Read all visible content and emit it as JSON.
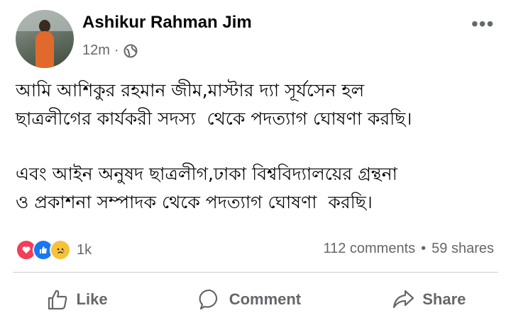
{
  "post": {
    "author": "Ashikur Rahman Jim",
    "time": "12m",
    "visibility_icon": "globe-icon",
    "paragraph1": "আমি আশিকুর রহমান জীম,মাস্টার দ্যা সূর্যসেন হল\nছাত্রলীগের কার্যকরী সদস্য  থেকে পদত্যাগ ঘোষণা করছি।",
    "paragraph2": "এবং আইন অনুষদ ছাত্রলীগ,ঢাকা বিশ্ববিদ্যালয়ের গ্রন্থনা\nও প্রকাশনা সম্পাদক থেকে পদত্যাগ ঘোষণা  করছি।"
  },
  "engagement": {
    "reaction_icons": [
      "love-icon",
      "like-icon",
      "sad-icon"
    ],
    "reaction_count": "1k",
    "comments": "112 comments",
    "separator": "•",
    "shares": "59 shares"
  },
  "actions": {
    "like": "Like",
    "comment": "Comment",
    "share": "Share"
  },
  "colors": {
    "secondary_text": "#65676b",
    "like_blue": "#1877f2",
    "love_red": "#f33e58",
    "sad_yellow": "#f7c23a"
  }
}
